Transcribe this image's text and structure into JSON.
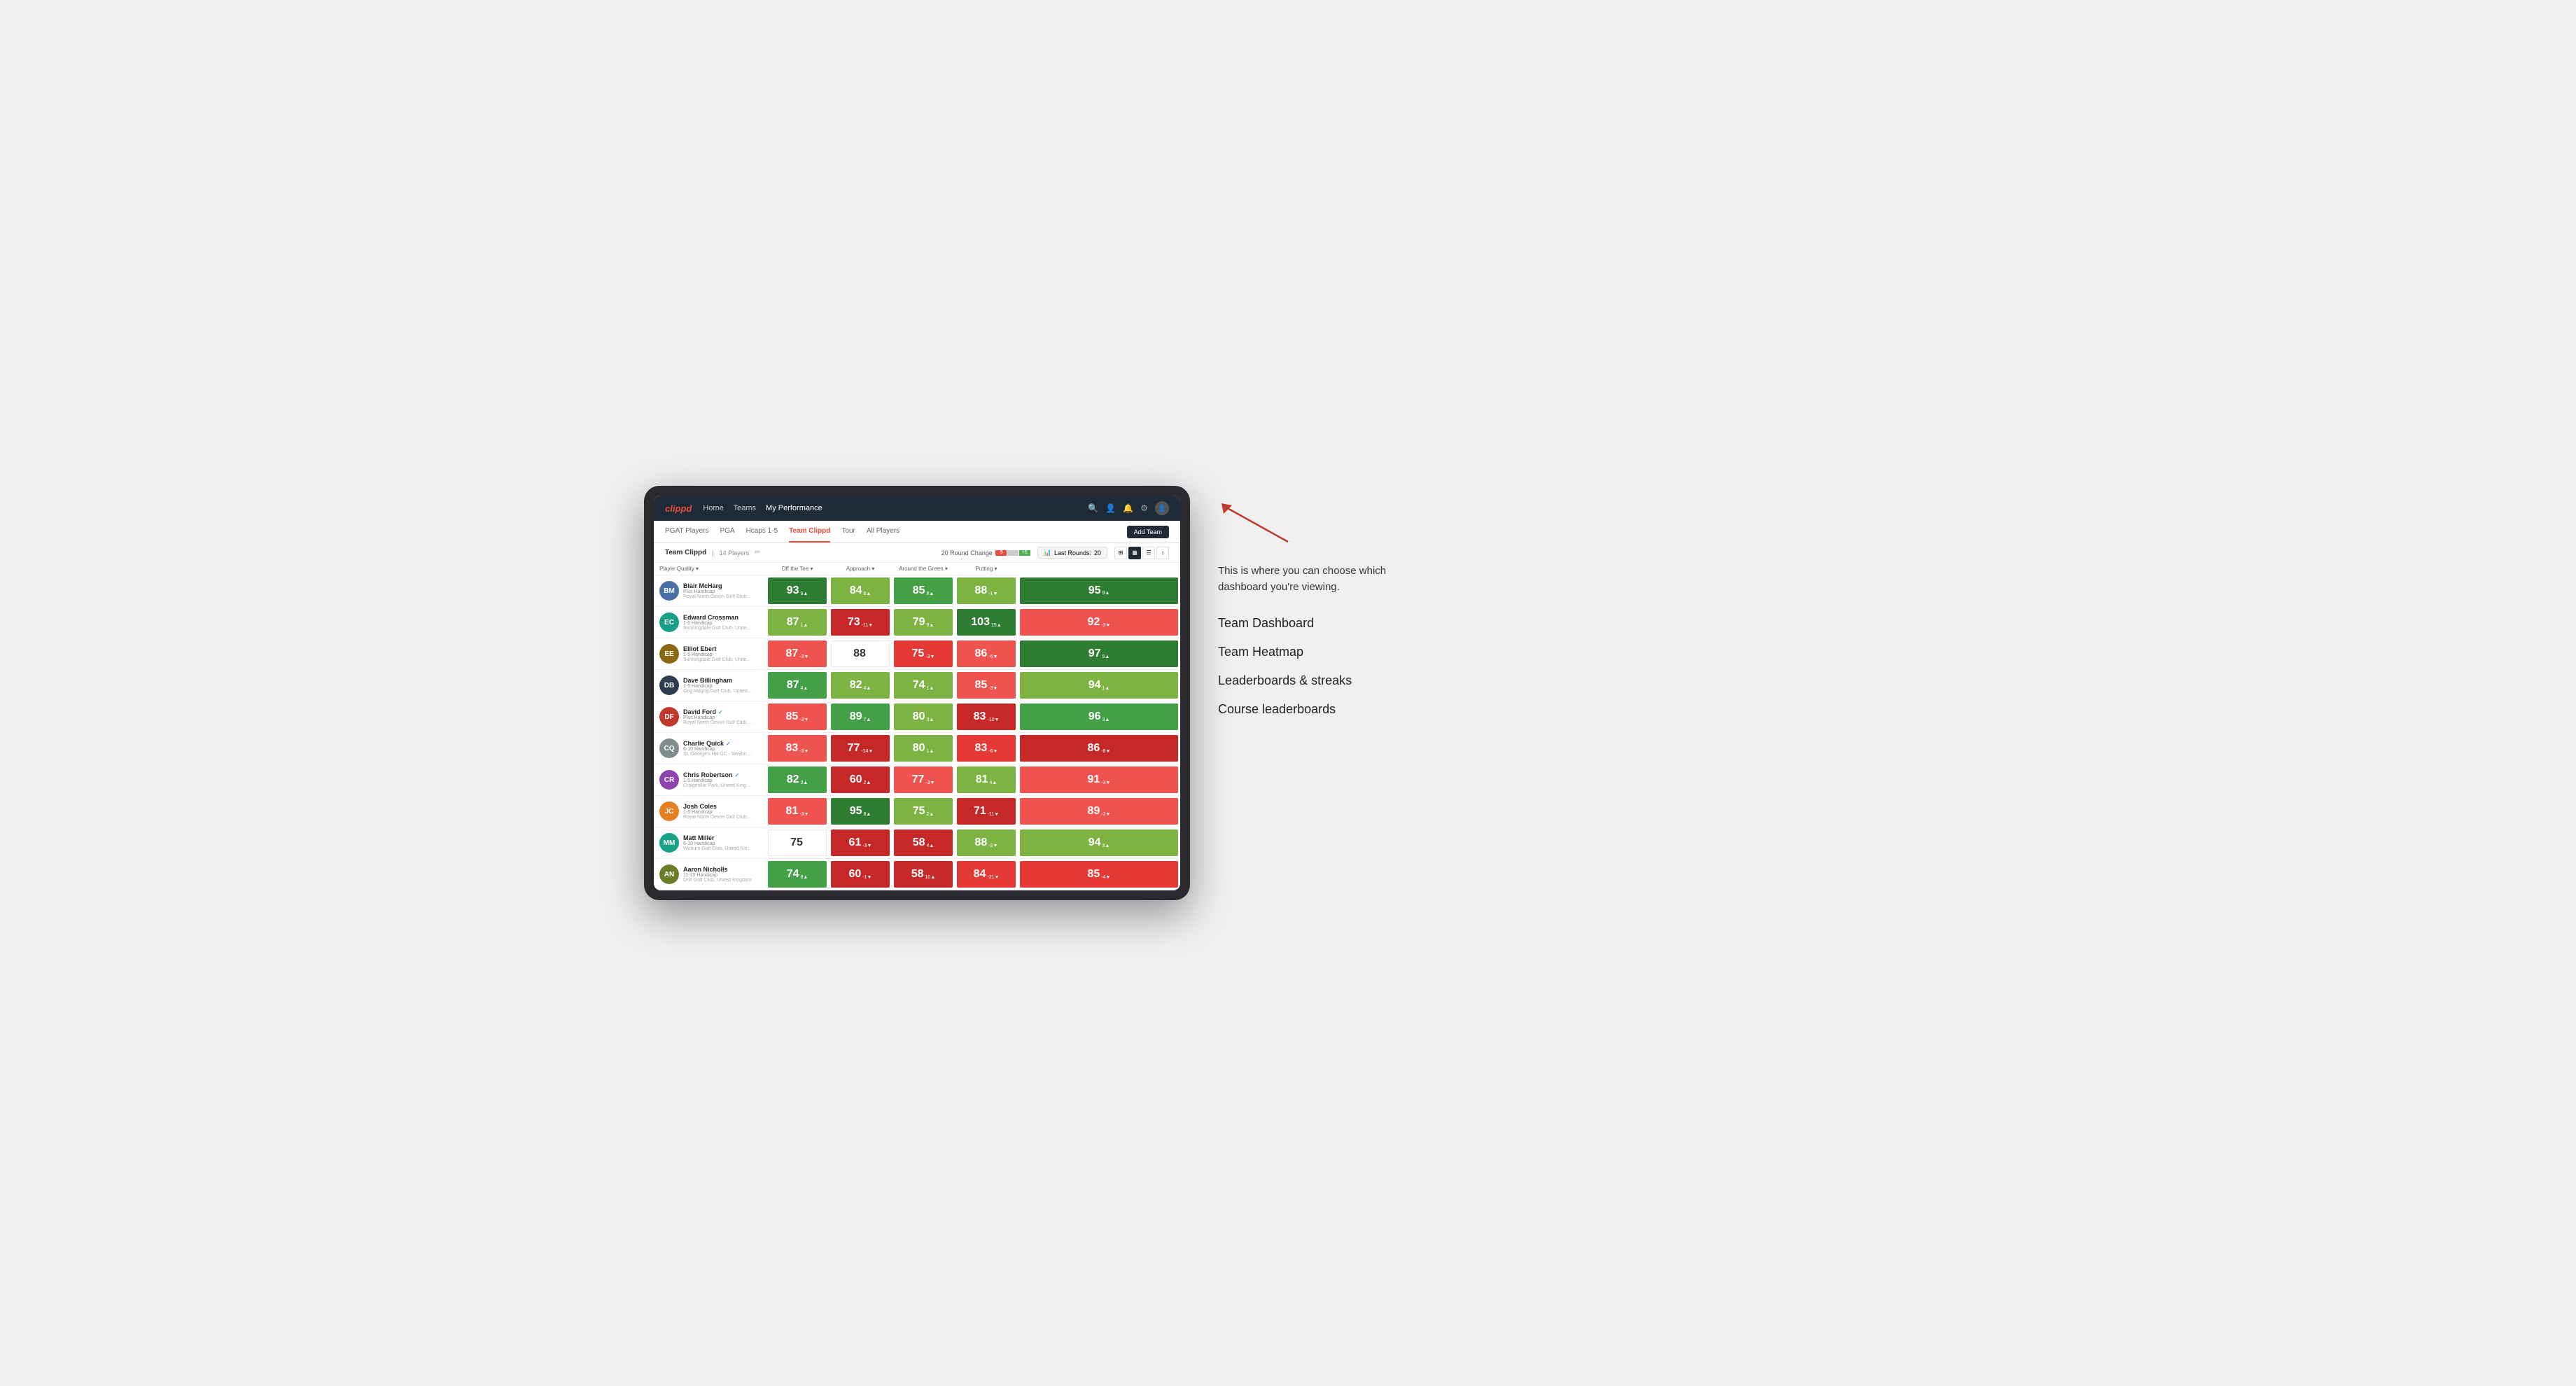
{
  "annotation": {
    "intro": "This is where you can choose which dashboard you're viewing.",
    "options": [
      "Team Dashboard",
      "Team Heatmap",
      "Leaderboards & streaks",
      "Course leaderboards"
    ]
  },
  "nav": {
    "logo": "clippd",
    "links": [
      {
        "label": "Home",
        "active": false
      },
      {
        "label": "Teams",
        "active": false
      },
      {
        "label": "My Performance",
        "active": true
      }
    ],
    "icons": {
      "search": "🔍",
      "user": "👤",
      "bell": "🔔",
      "settings": "⚙",
      "avatar": "👤"
    }
  },
  "sub_nav": {
    "links": [
      {
        "label": "PGAT Players",
        "active": false
      },
      {
        "label": "PGA",
        "active": false
      },
      {
        "label": "Hcaps 1-5",
        "active": false
      },
      {
        "label": "Team Clippd",
        "active": true
      },
      {
        "label": "Tour",
        "active": false
      },
      {
        "label": "All Players",
        "active": false
      }
    ],
    "add_team": "Add Team"
  },
  "team_header": {
    "title": "Team Clippd",
    "separator": "|",
    "count": "14 Players",
    "round_change_label": "20 Round Change",
    "change_neg": "-5",
    "change_pos": "+5",
    "last_rounds_label": "Last Rounds:",
    "last_rounds_value": "20",
    "views": [
      "grid",
      "heatmap",
      "list",
      "settings"
    ]
  },
  "table": {
    "headers": [
      {
        "label": "Player Quality ▾",
        "key": "player_quality"
      },
      {
        "label": "Off the Tee ▾",
        "key": "off_tee"
      },
      {
        "label": "Approach ▾",
        "key": "approach"
      },
      {
        "label": "Around the Green ▾",
        "key": "around_green"
      },
      {
        "label": "Putting ▾",
        "key": "putting"
      }
    ],
    "players": [
      {
        "name": "Blair McHarg",
        "handicap": "Plus Handicap",
        "club": "Royal North Devon Golf Club, United Kingdom",
        "initials": "BM",
        "av_class": "av-blue",
        "scores": [
          {
            "value": "93",
            "change": "9▲",
            "color": "score-green-dark"
          },
          {
            "value": "84",
            "change": "6▲",
            "color": "score-green-light"
          },
          {
            "value": "85",
            "change": "8▲",
            "color": "score-green-mid"
          },
          {
            "value": "88",
            "change": "-1▼",
            "color": "score-green-light"
          },
          {
            "value": "95",
            "change": "9▲",
            "color": "score-green-dark"
          }
        ]
      },
      {
        "name": "Edward Crossman",
        "handicap": "1-5 Handicap",
        "club": "Sunningdale Golf Club, United Kingdom",
        "initials": "EC",
        "av_class": "av-teal",
        "scores": [
          {
            "value": "87",
            "change": "1▲",
            "color": "score-green-light"
          },
          {
            "value": "73",
            "change": "-11▼",
            "color": "score-red-dark"
          },
          {
            "value": "79",
            "change": "9▲",
            "color": "score-green-light"
          },
          {
            "value": "103",
            "change": "15▲",
            "color": "score-green-dark"
          },
          {
            "value": "92",
            "change": "-3▼",
            "color": "score-red-light"
          }
        ]
      },
      {
        "name": "Elliot Ebert",
        "handicap": "1-5 Handicap",
        "club": "Sunningdale Golf Club, United Kingdom",
        "initials": "EE",
        "av_class": "av-brown",
        "scores": [
          {
            "value": "87",
            "change": "-3▼",
            "color": "score-red-light"
          },
          {
            "value": "88",
            "change": "",
            "color": "score-white"
          },
          {
            "value": "75",
            "change": "-3▼",
            "color": "score-red-mid"
          },
          {
            "value": "86",
            "change": "-6▼",
            "color": "score-red-light"
          },
          {
            "value": "97",
            "change": "5▲",
            "color": "score-green-dark"
          }
        ]
      },
      {
        "name": "Dave Billingham",
        "handicap": "1-5 Handicap",
        "club": "Gog Magog Golf Club, United Kingdom",
        "initials": "DB",
        "av_class": "av-dark",
        "scores": [
          {
            "value": "87",
            "change": "4▲",
            "color": "score-green-mid"
          },
          {
            "value": "82",
            "change": "4▲",
            "color": "score-green-light"
          },
          {
            "value": "74",
            "change": "1▲",
            "color": "score-green-light"
          },
          {
            "value": "85",
            "change": "-3▼",
            "color": "score-red-light"
          },
          {
            "value": "94",
            "change": "1▲",
            "color": "score-green-light"
          }
        ]
      },
      {
        "name": "David Ford",
        "verified": true,
        "handicap": "Plus Handicap",
        "club": "Royal North Devon Golf Club, United Kingdom",
        "initials": "DF",
        "av_class": "av-red",
        "scores": [
          {
            "value": "85",
            "change": "-3▼",
            "color": "score-red-light"
          },
          {
            "value": "89",
            "change": "7▲",
            "color": "score-green-mid"
          },
          {
            "value": "80",
            "change": "3▲",
            "color": "score-green-light"
          },
          {
            "value": "83",
            "change": "-10▼",
            "color": "score-red-dark"
          },
          {
            "value": "96",
            "change": "3▲",
            "color": "score-green-mid"
          }
        ]
      },
      {
        "name": "Charlie Quick",
        "verified": true,
        "handicap": "6-10 Handicap",
        "club": "St. George's Hill GC - Weybridge - Surrey, Uni...",
        "initials": "CQ",
        "av_class": "av-gray",
        "scores": [
          {
            "value": "83",
            "change": "-3▼",
            "color": "score-red-light"
          },
          {
            "value": "77",
            "change": "-14▼",
            "color": "score-red-dark"
          },
          {
            "value": "80",
            "change": "1▲",
            "color": "score-green-light"
          },
          {
            "value": "83",
            "change": "-6▼",
            "color": "score-red-mid"
          },
          {
            "value": "86",
            "change": "-8▼",
            "color": "score-red-dark"
          }
        ]
      },
      {
        "name": "Chris Robertson",
        "verified": true,
        "handicap": "1-5 Handicap",
        "club": "Craigmillar Park, United Kingdom",
        "initials": "CR",
        "av_class": "av-purple",
        "scores": [
          {
            "value": "82",
            "change": "3▲",
            "color": "score-green-mid"
          },
          {
            "value": "60",
            "change": "2▲",
            "color": "score-red-dark"
          },
          {
            "value": "77",
            "change": "-3▼",
            "color": "score-red-light"
          },
          {
            "value": "81",
            "change": "4▲",
            "color": "score-green-light"
          },
          {
            "value": "91",
            "change": "-3▼",
            "color": "score-red-light"
          }
        ]
      },
      {
        "name": "Josh Coles",
        "handicap": "1-5 Handicap",
        "club": "Royal North Devon Golf Club, United Kingdom",
        "initials": "JC",
        "av_class": "av-orange",
        "scores": [
          {
            "value": "81",
            "change": "-3▼",
            "color": "score-red-light"
          },
          {
            "value": "95",
            "change": "8▲",
            "color": "score-green-dark"
          },
          {
            "value": "75",
            "change": "2▲",
            "color": "score-green-light"
          },
          {
            "value": "71",
            "change": "-11▼",
            "color": "score-red-dark"
          },
          {
            "value": "89",
            "change": "-2▼",
            "color": "score-red-light"
          }
        ]
      },
      {
        "name": "Matt Miller",
        "handicap": "6-10 Handicap",
        "club": "Woburn Golf Club, United Kingdom",
        "initials": "MM",
        "av_class": "av-teal",
        "scores": [
          {
            "value": "75",
            "change": "",
            "color": "score-white"
          },
          {
            "value": "61",
            "change": "-3▼",
            "color": "score-red-dark"
          },
          {
            "value": "58",
            "change": "4▲",
            "color": "score-red-dark"
          },
          {
            "value": "88",
            "change": "-2▼",
            "color": "score-green-light"
          },
          {
            "value": "94",
            "change": "3▲",
            "color": "score-green-light"
          }
        ]
      },
      {
        "name": "Aaron Nicholls",
        "handicap": "11-15 Handicap",
        "club": "Drift Golf Club, United Kingdom",
        "initials": "AN",
        "av_class": "av-olive",
        "scores": [
          {
            "value": "74",
            "change": "8▲",
            "color": "score-green-mid"
          },
          {
            "value": "60",
            "change": "-1▼",
            "color": "score-red-dark"
          },
          {
            "value": "58",
            "change": "10▲",
            "color": "score-red-dark"
          },
          {
            "value": "84",
            "change": "-21▼",
            "color": "score-red-mid"
          },
          {
            "value": "85",
            "change": "-4▼",
            "color": "score-red-mid"
          }
        ]
      }
    ]
  }
}
